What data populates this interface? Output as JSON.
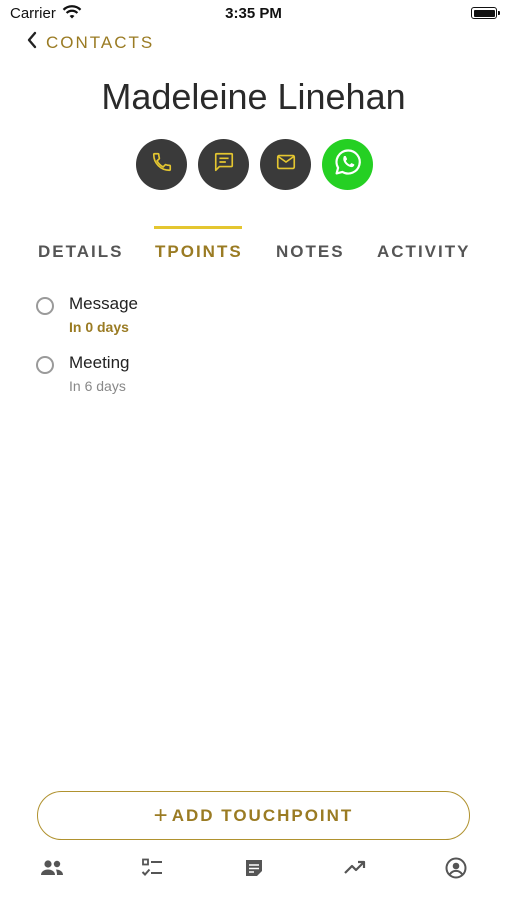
{
  "status_bar": {
    "carrier": "Carrier",
    "time": "3:35 PM"
  },
  "nav": {
    "back_label": "CONTACTS"
  },
  "contact": {
    "name": "Madeleine Linehan"
  },
  "actions": [
    {
      "icon": "phone-icon"
    },
    {
      "icon": "message-icon"
    },
    {
      "icon": "mail-icon"
    },
    {
      "icon": "whatsapp-icon"
    }
  ],
  "tabs": [
    {
      "label": "DETAILS",
      "active": false
    },
    {
      "label": "TPOINTS",
      "active": true
    },
    {
      "label": "NOTES",
      "active": false
    },
    {
      "label": "ACTIVITY",
      "active": false
    }
  ],
  "touchpoints": [
    {
      "title": "Message",
      "due": "In 0 days",
      "highlight": true
    },
    {
      "title": "Meeting",
      "due": "In 6 days",
      "highlight": false
    }
  ],
  "add_button": {
    "plus": "+",
    "label": "ADD TOUCHPOINT"
  },
  "tab_bar": [
    {
      "icon": "people-icon"
    },
    {
      "icon": "checklist-icon"
    },
    {
      "icon": "notes-icon"
    },
    {
      "icon": "trending-icon"
    },
    {
      "icon": "account-icon"
    }
  ],
  "colors": {
    "accent": "#9a7b23",
    "indicator": "#e4c630",
    "whatsapp": "#25d023",
    "action_bg": "#3a3a3a"
  }
}
